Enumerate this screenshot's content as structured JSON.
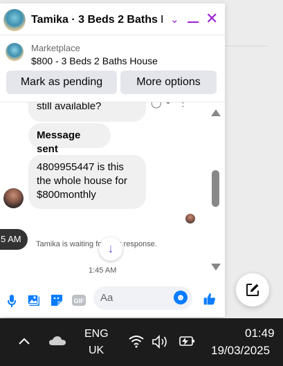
{
  "header": {
    "title": "Tamika · 3 Beds 2 Baths H..."
  },
  "marketplace": {
    "source": "Marketplace",
    "listing": "$800 - 3 Beds 2 Baths House",
    "mark_pending": "Mark as pending",
    "more_options": "More options"
  },
  "messages": [
    {
      "text": "still available?"
    },
    {
      "text": "Message sent"
    },
    {
      "text": "4809955447 is this the whole house for $800monthly"
    }
  ],
  "tooltip": "5 AM",
  "waiting_text": "Tamika is waiting for your response.",
  "timestamp": "1:45 AM",
  "composer": {
    "placeholder": "Aa"
  },
  "taskbar": {
    "lang_top": "ENG",
    "lang_bottom": "UK",
    "time": "01:49",
    "date": "19/03/2025"
  },
  "colors": {
    "accent": "#9b1fd4",
    "messenger_blue": "#0a7cff"
  }
}
